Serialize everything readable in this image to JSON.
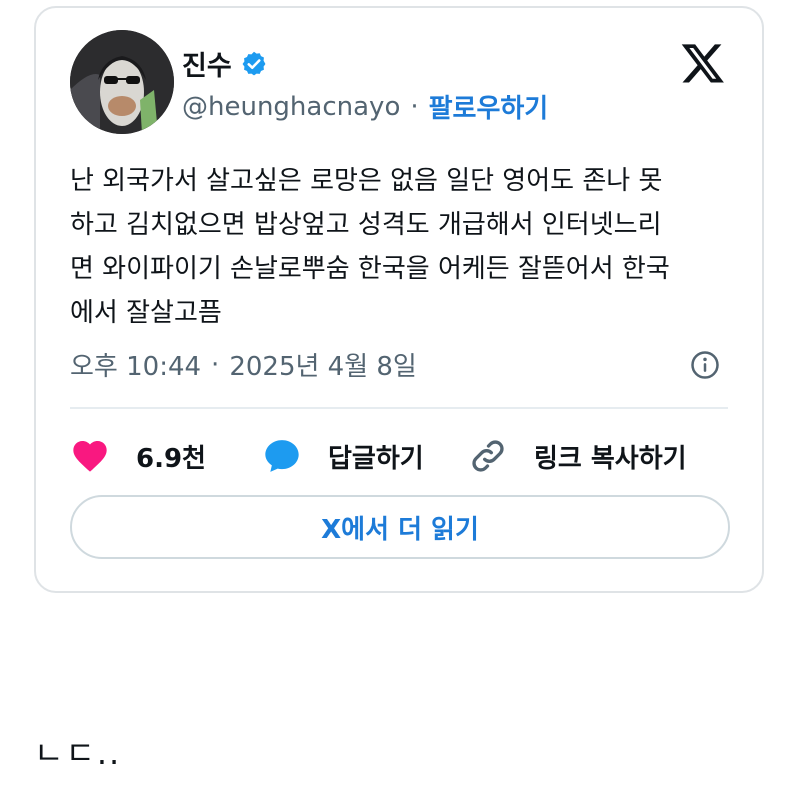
{
  "tweet": {
    "author_name": "진수",
    "handle": "@heunghacnayo",
    "separator": "·",
    "follow_label": "팔로우하기",
    "text": "난 외국가서 살고싶은 로망은 없음 일단 영어도 존나 못\n하고 김치없으면 밥상엎고 성격도 개급해서 인터넷느리\n면 와이파이기 손날로뿌숨 한국을 어케든 잘뜯어서 한국\n에서 잘살고픔",
    "time": "오후 10:44",
    "date": "2025년 4월 8일",
    "likes_count": "6.9천",
    "reply_label": "답글하기",
    "copy_link_label": "링크 복사하기",
    "read_more_label": "X에서 더 읽기"
  },
  "comment": {
    "text": "ㄴㄷ.."
  },
  "icons": {
    "verified": "verified-badge-icon",
    "platform": "x-logo-icon",
    "info": "info-icon",
    "like": "heart-icon",
    "reply": "speech-bubble-icon",
    "link": "link-icon"
  },
  "colors": {
    "accent": "#1d7bd8",
    "like": "#f91880",
    "verified": "#1d9bf0",
    "muted_text": "#536471"
  }
}
